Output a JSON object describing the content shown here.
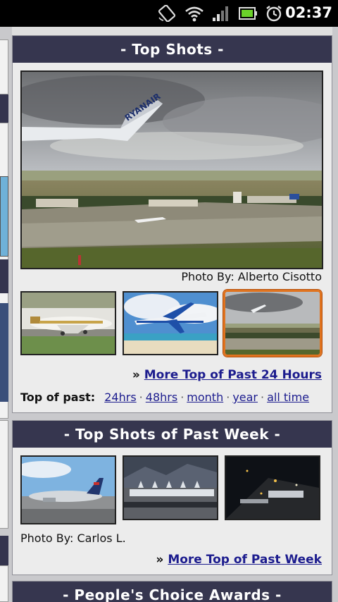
{
  "status_bar": {
    "time": "02:37",
    "icons": [
      "screen-rotation-icon",
      "wifi-icon",
      "signal-icon",
      "battery-icon",
      "alarm-icon"
    ]
  },
  "top_shots": {
    "title": "- Top Shots -",
    "main_photo_alt": "Airport view from aircraft window",
    "photo_credit": "Photo By: Alberto Cisotto",
    "more_prefix": "»",
    "more_link": "More Top of Past 24 Hours",
    "top_past_label": "Top of past:",
    "periods": [
      "24hrs",
      "48hrs",
      "month",
      "year",
      "all time"
    ],
    "separator": "·",
    "selected_thumb": 2
  },
  "top_week": {
    "title": "- Top Shots of Past Week -",
    "photo_credit": "Photo By: Carlos L.",
    "more_prefix": "»",
    "more_link": "More Top of Past Week"
  },
  "peoples_choice": {
    "title": "- People's Choice Awards -"
  },
  "colors": {
    "header_bg": "#36364f",
    "link": "#1c1c8e",
    "selected_border": "#e0731f",
    "panel_bg": "#ececec"
  }
}
